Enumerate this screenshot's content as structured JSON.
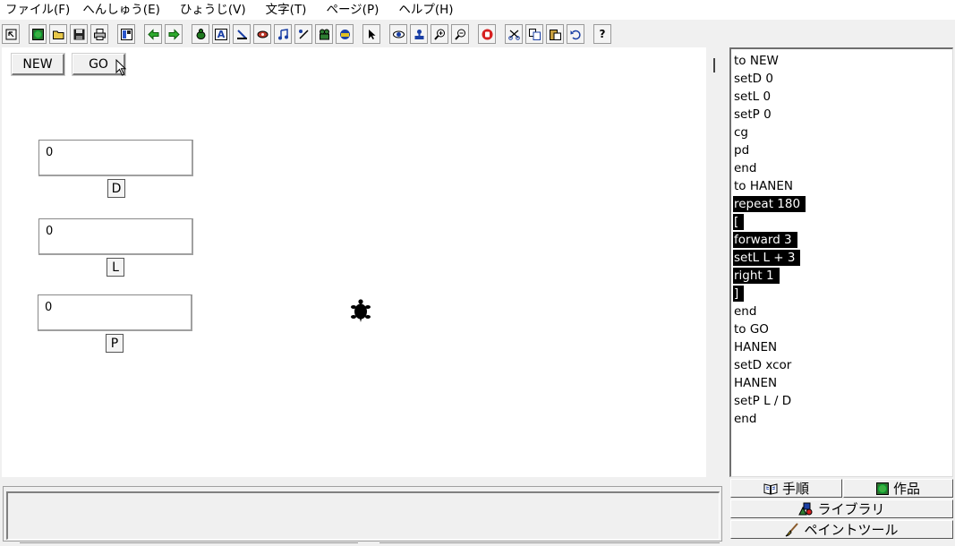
{
  "menu": [
    "ファイル(F)",
    "へんしゅう(E)",
    "ひょうじ(V)",
    "文字(T)",
    "ページ(P)",
    "ヘルプ(H)"
  ],
  "toolbar": {
    "icons": [
      "select-arrow-icon",
      "globe-icon",
      "open-folder-icon",
      "save-disk-icon",
      "print-icon",
      "layout-icon",
      "back-arrow-icon",
      "forward-arrow-icon",
      "turtle-new-icon",
      "text-box-icon",
      "paint-icon",
      "drawing-icon",
      "music-note-icon",
      "slider-icon",
      "movie-icon",
      "record-icon",
      "pointer-icon",
      "eye-icon",
      "stamp-icon",
      "zoom-in-icon",
      "zoom-out-icon",
      "stop-hand-icon",
      "cut-icon",
      "copy-icon",
      "paste-icon",
      "undo-icon",
      "help-icon"
    ],
    "text_box_glyph": "A",
    "help_glyph": "?"
  },
  "canvas": {
    "new_button": "NEW",
    "go_button": "GO",
    "fields": [
      {
        "value": "0",
        "label": "D"
      },
      {
        "value": "0",
        "label": "L"
      },
      {
        "value": "0",
        "label": "P"
      }
    ]
  },
  "code_lines": [
    {
      "text": "to NEW",
      "selected": false
    },
    {
      "text": "setD 0",
      "selected": false
    },
    {
      "text": "setL 0",
      "selected": false
    },
    {
      "text": "setP 0",
      "selected": false
    },
    {
      "text": "cg",
      "selected": false
    },
    {
      "text": "pd",
      "selected": false
    },
    {
      "text": "end",
      "selected": false
    },
    {
      "text": "to HANEN",
      "selected": false
    },
    {
      "text": "repeat 180",
      "selected": true
    },
    {
      "text": "[",
      "selected": true
    },
    {
      "text": "forward 3",
      "selected": true
    },
    {
      "text": "setL L + 3",
      "selected": true
    },
    {
      "text": "right 1",
      "selected": true
    },
    {
      "text": "]",
      "selected": true
    },
    {
      "text": "end",
      "selected": false
    },
    {
      "text": "to GO",
      "selected": false
    },
    {
      "text": "HANEN",
      "selected": false
    },
    {
      "text": "setD xcor",
      "selected": false
    },
    {
      "text": "HANEN",
      "selected": false
    },
    {
      "text": "setP L / D",
      "selected": false
    },
    {
      "text": "end",
      "selected": false
    }
  ],
  "tabs": {
    "procedures": "手順",
    "works": "作品",
    "library": "ライブラリ",
    "paint_tool": "ペイントツール"
  }
}
